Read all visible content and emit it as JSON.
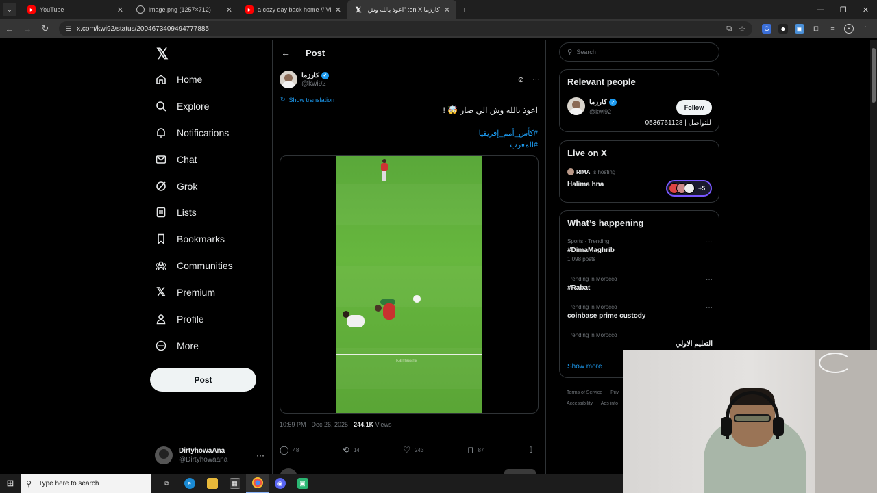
{
  "browser": {
    "tabs": [
      {
        "title": "YouTube",
        "icon": "youtube-icon",
        "active": false
      },
      {
        "title": "image.png (1257×712)",
        "icon": "globe-icon",
        "active": false
      },
      {
        "title": "a cozy day back home // VLOG",
        "icon": "youtube-icon",
        "active": false
      },
      {
        "title": "كارزما on X: \"اعوذ بالله وش ال",
        "icon": "x-icon",
        "active": true
      }
    ],
    "url": "x.com/kwi92/status/2004673409494777885"
  },
  "sidebar": {
    "items": [
      {
        "label": "Home",
        "icon": "home-icon"
      },
      {
        "label": "Explore",
        "icon": "search-icon"
      },
      {
        "label": "Notifications",
        "icon": "bell-icon"
      },
      {
        "label": "Chat",
        "icon": "mail-icon"
      },
      {
        "label": "Grok",
        "icon": "grok-icon"
      },
      {
        "label": "Lists",
        "icon": "list-icon"
      },
      {
        "label": "Bookmarks",
        "icon": "bookmark-icon"
      },
      {
        "label": "Communities",
        "icon": "people-icon"
      },
      {
        "label": "Premium",
        "icon": "x-logo-icon"
      },
      {
        "label": "Profile",
        "icon": "person-icon"
      },
      {
        "label": "More",
        "icon": "more-circle-icon"
      }
    ],
    "post_label": "Post",
    "account": {
      "name": "DirtyhowaAna",
      "handle": "@Dirtyhowaana"
    }
  },
  "main": {
    "title": "Post",
    "author": {
      "name": "كارزما",
      "handle": "@kwi92"
    },
    "show_translation": "Show translation",
    "text": "اعوذ بالله وش الي صار 🤯 !",
    "hashtags": [
      "#كأس_أمم_إفريقيا",
      "#المغرب"
    ],
    "video_watermark": "Karmaaana",
    "timestamp": "10:59 PM · Dec 26, 2025 · ",
    "views_count": "244.1K",
    "views_label": " Views",
    "actions": {
      "replies": "48",
      "reposts": "14",
      "likes": "243",
      "bookmarks": "87"
    }
  },
  "right": {
    "search_placeholder": "Search",
    "relevant_people": {
      "title": "Relevant people",
      "name": "كارزما",
      "handle": "@kwi92",
      "follow_label": "Follow",
      "bio": "للتواصل | 0536761128"
    },
    "live": {
      "title": "Live on X",
      "host": "RIMA",
      "host_suffix": "is hosting",
      "space_title": "Halima hna",
      "listeners_extra": "+5"
    },
    "happening": {
      "title": "What’s happening",
      "trends": [
        {
          "category": "Sports · Trending",
          "name": "#DimaMaghrib",
          "count": "1,098 posts"
        },
        {
          "category": "Trending in Morocco",
          "name": "#Rabat",
          "count": ""
        },
        {
          "category": "Trending in Morocco",
          "name": "coinbase prime custody",
          "count": ""
        },
        {
          "category": "Trending in Morocco",
          "name": "التعليم الاولي",
          "count": ""
        }
      ],
      "show_more": "Show more"
    },
    "footer": [
      "Terms of Service",
      "Priv",
      "Accessibility",
      "Ads info"
    ]
  },
  "taskbar": {
    "search_placeholder": "Type here to search"
  },
  "colors": {
    "accent": "#1d9bf0",
    "background": "#000000",
    "border": "#2f3336",
    "space_purple": "#7856ff"
  }
}
